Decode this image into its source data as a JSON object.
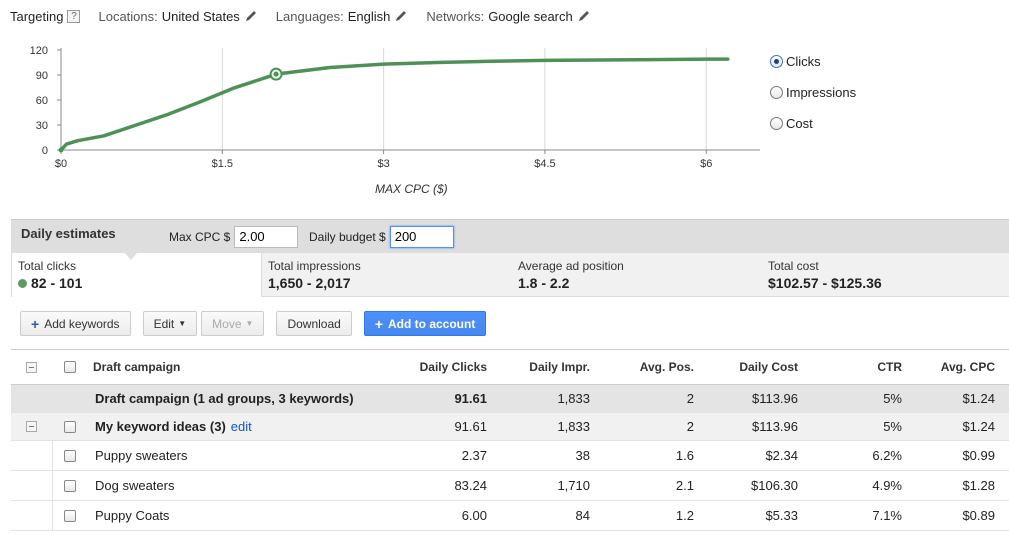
{
  "targeting": {
    "label": "Targeting",
    "help": "?",
    "items": [
      {
        "key": "Locations:",
        "value": "United States"
      },
      {
        "key": "Languages:",
        "value": "English"
      },
      {
        "key": "Networks:",
        "value": "Google search"
      }
    ]
  },
  "chart_data": {
    "type": "line",
    "xlabel": "MAX CPC ($)",
    "ylabel": "",
    "x_ticks": [
      "$0",
      "$1.5",
      "$3",
      "$4.5",
      "$6"
    ],
    "y_ticks": [
      "0",
      "30",
      "60",
      "90",
      "120"
    ],
    "xlim": [
      0,
      6.5
    ],
    "ylim": [
      0,
      120
    ],
    "grid": "vertical",
    "series": [
      {
        "color": "#4e9157",
        "x": [
          0,
          0.05,
          0.15,
          0.4,
          0.7,
          1.0,
          1.3,
          1.6,
          2.0,
          2.5,
          3.0,
          3.5,
          4.0,
          4.5,
          5.0,
          5.5,
          6.0,
          6.2
        ],
        "y": [
          0,
          7,
          11,
          17,
          30,
          43,
          58,
          74,
          91,
          99,
          103,
          105,
          106.5,
          107.5,
          108,
          108.5,
          109,
          109
        ]
      }
    ],
    "marker": {
      "x": 2.0,
      "y": 91
    }
  },
  "metric_radio": {
    "options": [
      "Clicks",
      "Impressions",
      "Cost"
    ],
    "selected": "Clicks"
  },
  "daily": {
    "title": "Daily estimates",
    "max_cpc_label": "Max CPC $",
    "max_cpc_value": "2.00",
    "budget_label": "Daily budget $",
    "budget_value": "200"
  },
  "stats": [
    {
      "label": "Total clicks",
      "value": "82 - 101"
    },
    {
      "label": "Total impressions",
      "value": "1,650 - 2,017"
    },
    {
      "label": "Average ad position",
      "value": "1.8 - 2.2"
    },
    {
      "label": "Total cost",
      "value": "$102.57 - $125.36"
    }
  ],
  "toolbar": {
    "add_keywords": "Add keywords",
    "edit": "Edit",
    "move": "Move",
    "download": "Download",
    "add_to_account": "Add to account"
  },
  "table": {
    "columns": [
      "Draft campaign",
      "Daily Clicks",
      "Daily Impr.",
      "Avg. Pos.",
      "Daily Cost",
      "CTR",
      "Avg. CPC"
    ],
    "summary": {
      "name": "Draft campaign (1 ad groups, 3 keywords)",
      "clicks": "91.61",
      "impr": "1,833",
      "pos": "2",
      "cost": "$113.96",
      "ctr": "5%",
      "cpc": "$1.24"
    },
    "group": {
      "name": "My keyword ideas (3)",
      "edit": "edit",
      "clicks": "91.61",
      "impr": "1,833",
      "pos": "2",
      "cost": "$113.96",
      "ctr": "5%",
      "cpc": "$1.24"
    },
    "rows": [
      {
        "name": "Puppy sweaters",
        "clicks": "2.37",
        "impr": "38",
        "pos": "1.6",
        "cost": "$2.34",
        "ctr": "6.2%",
        "cpc": "$0.99"
      },
      {
        "name": "Dog sweaters",
        "clicks": "83.24",
        "impr": "1,710",
        "pos": "2.1",
        "cost": "$106.30",
        "ctr": "4.9%",
        "cpc": "$1.28"
      },
      {
        "name": "Puppy Coats",
        "clicks": "6.00",
        "impr": "84",
        "pos": "1.2",
        "cost": "$5.33",
        "ctr": "7.1%",
        "cpc": "$0.89"
      }
    ]
  }
}
